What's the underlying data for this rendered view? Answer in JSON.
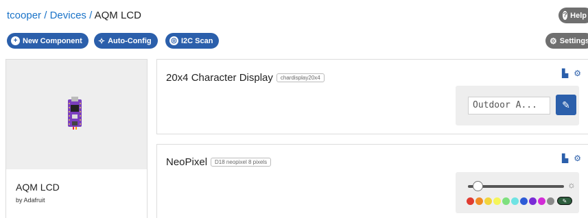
{
  "breadcrumb": {
    "user": "tcooper",
    "section": "Devices",
    "separator": "/",
    "current": "AQM LCD"
  },
  "toolbar": {
    "new_component": "New Component",
    "auto_config": "Auto-Config",
    "i2c_scan": "I2C Scan",
    "help": "Help",
    "settings": "Settings"
  },
  "device": {
    "name": "AQM LCD",
    "by": "by Adafruit"
  },
  "components": [
    {
      "title": "20x4 Character Display",
      "tag": "chardisplay20x4",
      "input_value": "Outdoor A..."
    },
    {
      "title": "NeoPixel",
      "tag": "D18 neopixel 8 pixels",
      "brightness": 0.1,
      "swatches": [
        "#e03c31",
        "#f08a24",
        "#f2d43c",
        "#f5f55a",
        "#7ee07e",
        "#6fe3e3",
        "#2d5bd6",
        "#7a2bd6",
        "#d22bd6",
        "#8a8a8a"
      ]
    }
  ],
  "colors": {
    "primary": "#2b5fab",
    "secondary": "#6f6f6f",
    "link": "#1a73c8"
  },
  "icons": [
    "plus-circle-icon",
    "magic-wand-icon",
    "i2c-icon",
    "question-icon",
    "gear-icon",
    "chart-icon",
    "pencil-icon",
    "sun-icon"
  ]
}
